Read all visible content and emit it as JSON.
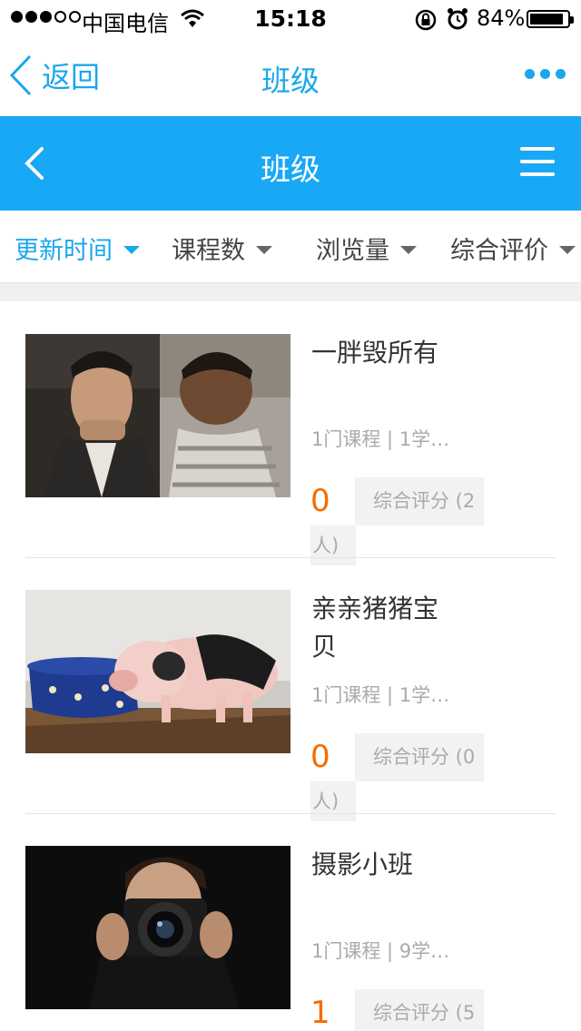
{
  "status_bar": {
    "carrier": "中国电信",
    "time": "15:18",
    "battery_percent": "84%"
  },
  "top_nav": {
    "back_label": "返回",
    "title": "班级"
  },
  "header": {
    "title": "班级"
  },
  "sort_tabs": [
    {
      "label": "更新时间",
      "active": true
    },
    {
      "label": "课程数",
      "active": false
    },
    {
      "label": "浏览量",
      "active": false
    },
    {
      "label": "综合评价",
      "active": false
    }
  ],
  "classes": [
    {
      "name": "一胖毁所有",
      "meta": "1门课程 | 1学…",
      "score": "0",
      "rating_label": "综合评分 (2",
      "rating_tail": "人)"
    },
    {
      "name": "亲亲猪猪宝贝",
      "meta": "1门课程 | 1学…",
      "score": "0",
      "rating_label": "综合评分 (0",
      "rating_tail": "人)"
    },
    {
      "name": "摄影小班",
      "meta": "1门课程 | 9学…",
      "score": "1",
      "rating_label": "综合评分 (5",
      "rating_tail": ""
    }
  ],
  "colors": {
    "accent": "#1aa7ec",
    "header_bg": "#18a8f5",
    "score": "#f76b00"
  }
}
